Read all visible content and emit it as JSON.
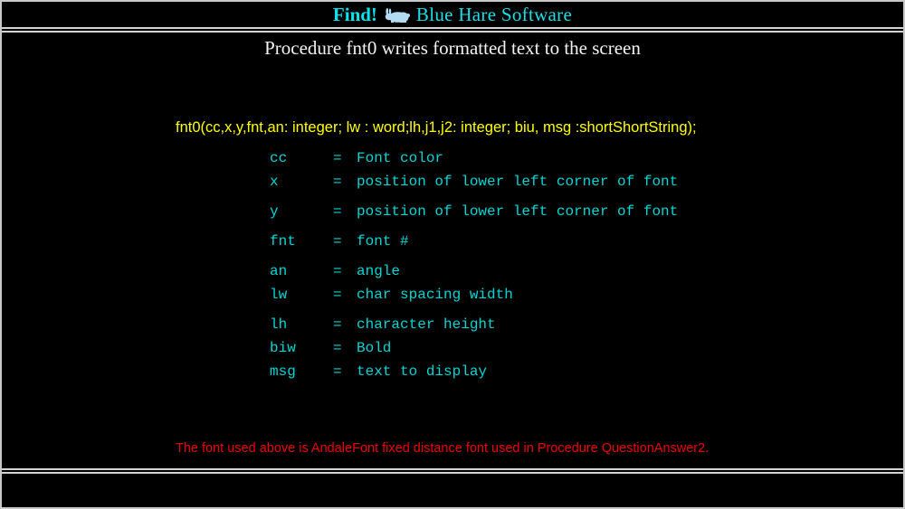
{
  "window": {
    "frame_color": "#c8c8c8",
    "background_color": "#000000"
  },
  "title_bar": {
    "find_label": "Find!",
    "hare_icon_name": "blue-hare-icon",
    "hare_icon_color": "#b3dcf2",
    "brand_label": "Blue Hare Software",
    "accent_color": "#00e5ee"
  },
  "content": {
    "subtitle": "Procedure fnt0 writes formatted text to the screen",
    "subtitle_color": "#f2f2f2",
    "signature": "fnt0(cc,x,y,fnt,an: integer; lw : word;lh,j1,j2: integer; biu, msg :shortShortString);",
    "signature_color": "#ffff00",
    "param_color": "#00d5d5",
    "equals": "=",
    "parameters": [
      {
        "key": "cc",
        "desc": "Font color",
        "gap_before": false
      },
      {
        "key": "x",
        "desc": "position of lower left corner of font",
        "gap_before": false
      },
      {
        "key": "y",
        "desc": "position of lower left corner of font",
        "gap_before": true
      },
      {
        "key": "fnt",
        "desc": "font #",
        "gap_before": true
      },
      {
        "key": "an",
        "desc": "angle",
        "gap_before": true
      },
      {
        "key": "lw",
        "desc": "char spacing width",
        "gap_before": false
      },
      {
        "key": "lh",
        "desc": "character height",
        "gap_before": true
      },
      {
        "key": "biw",
        "desc": "Bold",
        "gap_before": false
      },
      {
        "key": "msg",
        "desc": "text to display",
        "gap_before": false
      }
    ],
    "footnote": "The font used above is AndaleFont fixed distance font used in Procedure QuestionAnswer2.",
    "footnote_color": "#ee0000"
  },
  "status_bar": {
    "text": ""
  }
}
